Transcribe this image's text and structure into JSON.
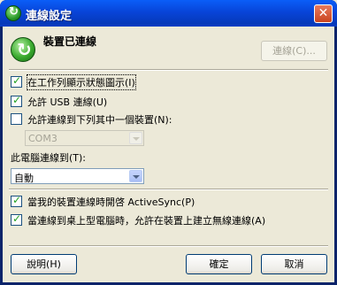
{
  "window": {
    "title": "連線設定",
    "close_glyph": "✕"
  },
  "status": {
    "text": "裝置已連線",
    "connect_label": "連線(C)..."
  },
  "options": {
    "show_status_icon": {
      "label": "在工作列顯示狀態圖示(I)",
      "checked": true
    },
    "allow_usb": {
      "label": "允許 USB 連線(U)",
      "checked": true
    },
    "allow_device": {
      "label": "允許連線到下列其中一個裝置(N):",
      "checked": false
    }
  },
  "com_port": {
    "value": "COM3"
  },
  "pc_connect": {
    "label": "此電腦連線到(T):",
    "value": "自動"
  },
  "activesync": {
    "label": "當我的裝置連線時開啓 ActiveSync(P)",
    "checked": true
  },
  "wireless": {
    "label": "當連線到桌上型電腦時，允許在裝置上建立無線連線(A)",
    "checked": true
  },
  "buttons": {
    "help": "說明(H)",
    "ok": "確定",
    "cancel": "取消"
  }
}
